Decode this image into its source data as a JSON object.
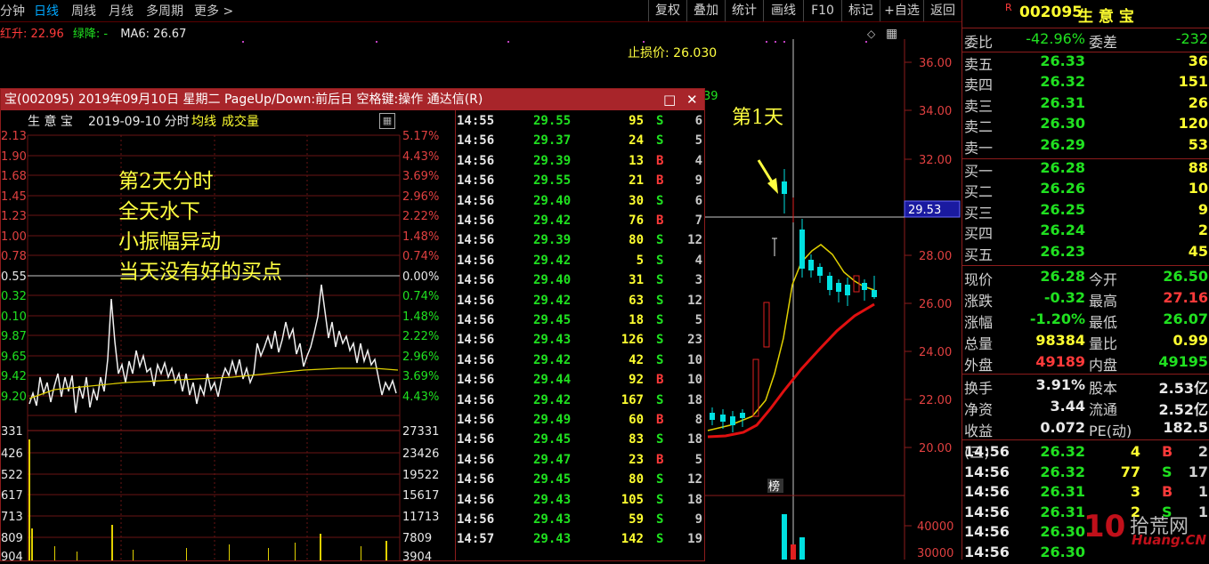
{
  "toolbar": {
    "periods": [
      "分钟",
      "日线",
      "周线",
      "月线",
      "多周期",
      "更多 >"
    ],
    "buttons": [
      "复权",
      "叠加",
      "统计",
      "画线",
      "F10",
      "标记",
      "+自选",
      "返回"
    ]
  },
  "ma_line": {
    "hong_label": "红升: 22.96",
    "lv_label": "绿降: -",
    "ma6_label": "MA6: 26.67"
  },
  "kline": {
    "stop_loss": "止损价: 26.030",
    "annotation_day1": "第1天",
    "cursor_price": "29.53",
    "bang_label": "榜",
    "price_axis": [
      "36.00",
      "34.00",
      "32.00",
      "28.00",
      "26.00",
      "24.00",
      "22.00",
      "20.00"
    ],
    "vol_axis": [
      "40000",
      "30000"
    ],
    "partial_label": "39",
    "diamond": "◇",
    "grid_icon": "▦"
  },
  "popup": {
    "title": "宝(002095) 2019年09月10日 星期二 PageUp/Down:前后日 空格键:操作 通达信(R)",
    "minimize": "□",
    "close": "✕",
    "subhead_name": "生 意 宝",
    "subhead_date": "2019-09-10 分时",
    "subhead_avg": "均线",
    "subhead_vol": "成交量",
    "annotations": [
      "第2天分时",
      "全天水下",
      "小振幅异动",
      "当天没有好的买点"
    ],
    "left_axis": [
      "2.13",
      "1.90",
      "1.68",
      "1.45",
      "1.23",
      "1.00",
      "0.78",
      "0.55",
      "0.32",
      "0.10",
      "9.87",
      "9.65",
      "9.42",
      "9.20"
    ],
    "right_axis": [
      "5.17%",
      "4.43%",
      "3.69%",
      "2.96%",
      "2.22%",
      "1.48%",
      "0.74%",
      "0.00%",
      "0.74%",
      "1.48%",
      "2.22%",
      "2.96%",
      "3.69%",
      "4.43%"
    ],
    "vol_left": [
      "331",
      "426",
      "522",
      "617",
      "713",
      "809",
      "904"
    ],
    "vol_right": [
      "27331",
      "23426",
      "19522",
      "15617",
      "11713",
      "7809",
      "3904"
    ],
    "ticks": [
      {
        "time": "14:55",
        "price": "29.55",
        "vol": "95",
        "side": "S",
        "n": "6"
      },
      {
        "time": "14:56",
        "price": "29.37",
        "vol": "24",
        "side": "S",
        "n": "5"
      },
      {
        "time": "14:56",
        "price": "29.39",
        "vol": "13",
        "side": "B",
        "n": "4"
      },
      {
        "time": "14:56",
        "price": "29.55",
        "vol": "21",
        "side": "B",
        "n": "9"
      },
      {
        "time": "14:56",
        "price": "29.40",
        "vol": "30",
        "side": "S",
        "n": "6"
      },
      {
        "time": "14:56",
        "price": "29.42",
        "vol": "76",
        "side": "B",
        "n": "7"
      },
      {
        "time": "14:56",
        "price": "29.39",
        "vol": "80",
        "side": "S",
        "n": "12"
      },
      {
        "time": "14:56",
        "price": "29.42",
        "vol": "5",
        "side": "S",
        "n": "4"
      },
      {
        "time": "14:56",
        "price": "29.40",
        "vol": "31",
        "side": "S",
        "n": "3"
      },
      {
        "time": "14:56",
        "price": "29.42",
        "vol": "63",
        "side": "S",
        "n": "12"
      },
      {
        "time": "14:56",
        "price": "29.45",
        "vol": "18",
        "side": "S",
        "n": "5"
      },
      {
        "time": "14:56",
        "price": "29.43",
        "vol": "126",
        "side": "S",
        "n": "23"
      },
      {
        "time": "14:56",
        "price": "29.42",
        "vol": "42",
        "side": "S",
        "n": "10"
      },
      {
        "time": "14:56",
        "price": "29.44",
        "vol": "92",
        "side": "B",
        "n": "10"
      },
      {
        "time": "14:56",
        "price": "29.42",
        "vol": "167",
        "side": "S",
        "n": "18"
      },
      {
        "time": "14:56",
        "price": "29.49",
        "vol": "60",
        "side": "B",
        "n": "8"
      },
      {
        "time": "14:56",
        "price": "29.45",
        "vol": "83",
        "side": "S",
        "n": "18"
      },
      {
        "time": "14:56",
        "price": "29.47",
        "vol": "23",
        "side": "B",
        "n": "5"
      },
      {
        "time": "14:56",
        "price": "29.45",
        "vol": "80",
        "side": "S",
        "n": "12"
      },
      {
        "time": "14:56",
        "price": "29.43",
        "vol": "105",
        "side": "S",
        "n": "18"
      },
      {
        "time": "14:56",
        "price": "29.43",
        "vol": "59",
        "side": "S",
        "n": "9"
      },
      {
        "time": "14:57",
        "price": "29.43",
        "vol": "142",
        "side": "S",
        "n": "19"
      }
    ]
  },
  "quote": {
    "r_mark": "R",
    "code": "002095",
    "name": "生 意 宝",
    "weibi_label": "委比",
    "weibi": "-42.96%",
    "weicha_label": "委差",
    "weicha": "-232",
    "asks": [
      {
        "label": "卖五",
        "price": "26.33",
        "vol": "36"
      },
      {
        "label": "卖四",
        "price": "26.32",
        "vol": "151"
      },
      {
        "label": "卖三",
        "price": "26.31",
        "vol": "26"
      },
      {
        "label": "卖二",
        "price": "26.30",
        "vol": "120"
      },
      {
        "label": "卖一",
        "price": "26.29",
        "vol": "53"
      }
    ],
    "bids": [
      {
        "label": "买一",
        "price": "26.28",
        "vol": "88"
      },
      {
        "label": "买二",
        "price": "26.26",
        "vol": "10"
      },
      {
        "label": "买三",
        "price": "26.25",
        "vol": "9"
      },
      {
        "label": "买四",
        "price": "26.24",
        "vol": "2"
      },
      {
        "label": "买五",
        "price": "26.23",
        "vol": "45"
      }
    ],
    "stats": [
      {
        "l1": "现价",
        "v1": "26.28",
        "l2": "今开",
        "v2": "26.50"
      },
      {
        "l1": "涨跌",
        "v1": "-0.32",
        "l2": "最高",
        "v2": "27.16"
      },
      {
        "l1": "涨幅",
        "v1": "-1.20%",
        "l2": "最低",
        "v2": "26.07"
      },
      {
        "l1": "总量",
        "v1": "98384",
        "l2": "量比",
        "v2": "0.99"
      },
      {
        "l1": "外盘",
        "v1": "49189",
        "l2": "内盘",
        "v2": "49195"
      }
    ],
    "stats2": [
      {
        "l1": "换手",
        "v1": "3.91%",
        "l2": "股本",
        "v2": "2.53亿"
      },
      {
        "l1": "净资",
        "v1": "3.44",
        "l2": "流通",
        "v2": "2.52亿"
      },
      {
        "l1": "收益(三)",
        "v1": "0.072",
        "l2": "PE(动)",
        "v2": "182.5"
      }
    ],
    "trades": [
      {
        "time": "14:56",
        "price": "26.32",
        "vol": "4",
        "side": "B",
        "n": "2"
      },
      {
        "time": "14:56",
        "price": "26.32",
        "vol": "77",
        "side": "S",
        "n": "17"
      },
      {
        "time": "14:56",
        "price": "26.31",
        "vol": "3",
        "side": "B",
        "n": "1"
      },
      {
        "time": "14:56",
        "price": "26.31",
        "vol": "2",
        "side": "S",
        "n": "1"
      },
      {
        "time": "14:56",
        "price": "26.30",
        "vol": "",
        "side": "",
        "n": ""
      },
      {
        "time": "14:56",
        "price": "26.30",
        "vol": "",
        "side": "",
        "n": ""
      }
    ]
  },
  "watermark": {
    "digits": "10",
    "brand": "拾荒网",
    "url": "Huang.CN"
  }
}
